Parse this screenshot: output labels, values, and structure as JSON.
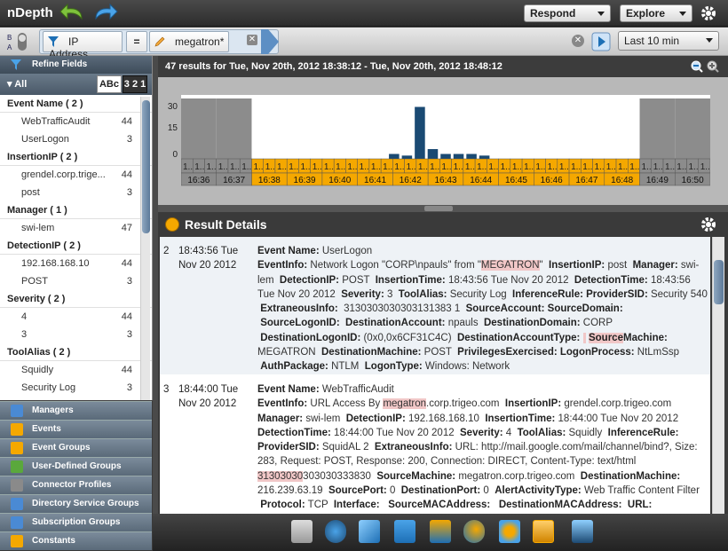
{
  "app": {
    "title": "nDepth"
  },
  "toolbar": {
    "respond_label": "Respond",
    "explore_label": "Explore"
  },
  "filter": {
    "field_label": "IP Address",
    "operator": "=",
    "value": "megatron*",
    "timerange": "Last 10 min"
  },
  "sidebar": {
    "refine_label": "Refine Fields",
    "all_label": "All",
    "sort_alpha": "ABc",
    "sort_num": "3 2 1",
    "groups": [
      {
        "header": "Event Name ( 2 )",
        "items": [
          {
            "label": "WebTrafficAudit",
            "count": "44"
          },
          {
            "label": "UserLogon",
            "count": "3"
          }
        ]
      },
      {
        "header": "InsertionIP ( 2 )",
        "items": [
          {
            "label": "grendel.corp.trige...",
            "count": "44"
          },
          {
            "label": "post",
            "count": "3"
          }
        ]
      },
      {
        "header": "Manager ( 1 )",
        "items": [
          {
            "label": "swi-lem",
            "count": "47"
          }
        ]
      },
      {
        "header": "DetectionIP ( 2 )",
        "items": [
          {
            "label": "192.168.168.10",
            "count": "44"
          },
          {
            "label": "POST",
            "count": "3"
          }
        ]
      },
      {
        "header": "Severity ( 2 )",
        "items": [
          {
            "label": "4",
            "count": "44"
          },
          {
            "label": "3",
            "count": "3"
          }
        ]
      },
      {
        "header": "ToolAlias ( 2 )",
        "items": [
          {
            "label": "Squidly",
            "count": "44"
          },
          {
            "label": "Security Log",
            "count": "3"
          }
        ]
      }
    ],
    "nav": [
      "Managers",
      "Events",
      "Event Groups",
      "User-Defined Groups",
      "Connector Profiles",
      "Directory Service Groups",
      "Subscription Groups",
      "Constants"
    ]
  },
  "results": {
    "summary": "47 results for Tue, Nov 20th, 2012 18:38:12 - Tue, Nov 20th, 2012 18:48:12",
    "details_title": "Result Details"
  },
  "chart_data": {
    "type": "bar",
    "yticks": [
      "30",
      "15",
      "0"
    ],
    "ylim": [
      0,
      35
    ],
    "bar_values": [
      0,
      0,
      0,
      0,
      0,
      0,
      0,
      0,
      0,
      0,
      0,
      0,
      0,
      0,
      0,
      0,
      3,
      2,
      32,
      6,
      3,
      3,
      3,
      2,
      0,
      0,
      0,
      0,
      0,
      0,
      0,
      0,
      0,
      0,
      0,
      0,
      0,
      0,
      0,
      0,
      0
    ],
    "minute_labels": [
      "16:36",
      "16:37",
      "16:38",
      "16:39",
      "16:40",
      "16:41",
      "16:42",
      "16:43",
      "16:44",
      "16:45",
      "16:46",
      "16:47",
      "16:48",
      "16:49",
      "16:50"
    ],
    "selected_minutes": [
      "16:38",
      "16:39",
      "16:40",
      "16:41",
      "16:42",
      "16:43",
      "16:44",
      "16:45",
      "16:46",
      "16:47",
      "16:48"
    ],
    "sub_label": "1...",
    "colors": {
      "selected": "#f5a800",
      "unselected": "#8c8c8c",
      "bar": "#1a4a73"
    }
  },
  "records": [
    {
      "index": "2",
      "time": "18:43:56 Tue Nov 20 2012",
      "fields_html": "<b>Event Name:</b> UserLogon<br><b>EventInfo:</b> Network Logon \"CORP\\npauls\" from \"<span class='hl'>MEGATRON</span>\" &nbsp;<b>InsertionIP:</b> post &nbsp;<b>Manager:</b> swi-lem &nbsp;<b>DetectionIP:</b> POST &nbsp;<b>InsertionTime:</b> 18:43:56 Tue Nov 20 2012 &nbsp;<b>DetectionTime:</b> 18:43:56 Tue Nov 20 2012 &nbsp;<b>Severity:</b> 3 &nbsp;<b>ToolAlias:</b> Security Log &nbsp;<b>InferenceRule:</b> <b>ProviderSID:</b> Security 540 &nbsp;<b>ExtraneousInfo:</b> &nbsp;3130303030303131383 1 &nbsp;<b>SourceAccount:</b> <b>SourceDomain:</b> &nbsp;<b>SourceLogonID:</b> &nbsp;<b>DestinationAccount:</b> npauls &nbsp;<b>DestinationDomain:</b> CORP &nbsp;<b>DestinationLogonID:</b> (0x0,0x6CF31C4C) &nbsp;<b>DestinationAccountType:</b> <span class='hl'>&nbsp;</span> <b><span class='hl'>Source</span>Machine:</b> MEGATRON &nbsp;<b>DestinationMachine:</b> POST &nbsp;<b>PrivilegesExercised:</b> <b>LogonProcess:</b> NtLmSsp &nbsp;<b>AuthPackage:</b> NTLM &nbsp;<b>LogonType:</b> Windows: Network"
    },
    {
      "index": "3",
      "time": "18:44:00 Tue Nov 20 2012",
      "fields_html": "<b>Event Name:</b> WebTrafficAudit<br><b>EventInfo:</b> URL Access By <span class='hl'>megatron</span>.corp.trigeo.com &nbsp;<b>InsertionIP:</b> grendel.corp.trigeo.com <b>Manager:</b> swi-lem &nbsp;<b>DetectionIP:</b> 192.168.168.10 &nbsp;<b>InsertionTime:</b> 18:44:00 Tue Nov 20 2012 <b>DetectionTime:</b> 18:44:00 Tue Nov 20 2012 &nbsp;<b>Severity:</b> 4 &nbsp;<b>ToolAlias:</b> Squidly &nbsp;<b>InferenceRule:</b> <b>ProviderSID:</b> SquidAL 2 &nbsp;<b>ExtraneousInfo:</b> URL: http://mail.google.com/mail/channel/bind?, Size: 283, Request: POST, Response: 200, Connection: DIRECT, Content-Type: text/html <span class='hl'>31303030</span>303030333830 &nbsp;<b>SourceMachine:</b> megatron.corp.trigeo.com &nbsp;<b>DestinationMachine:</b> 216.239.63.19 &nbsp;<b>SourcePort:</b> 0 &nbsp;<b>DestinationPort:</b> 0 &nbsp;<b>AlertActivityType:</b> Web Traffic Content Filter &nbsp;<b>Protocol:</b> TCP &nbsp;<b>Interface:</b> &nbsp;&nbsp;<b>SourceMACAddress:</b> &nbsp;&nbsp;<b>DestinationMACAddress:</b> &nbsp;<b>URL:</b>"
    }
  ]
}
